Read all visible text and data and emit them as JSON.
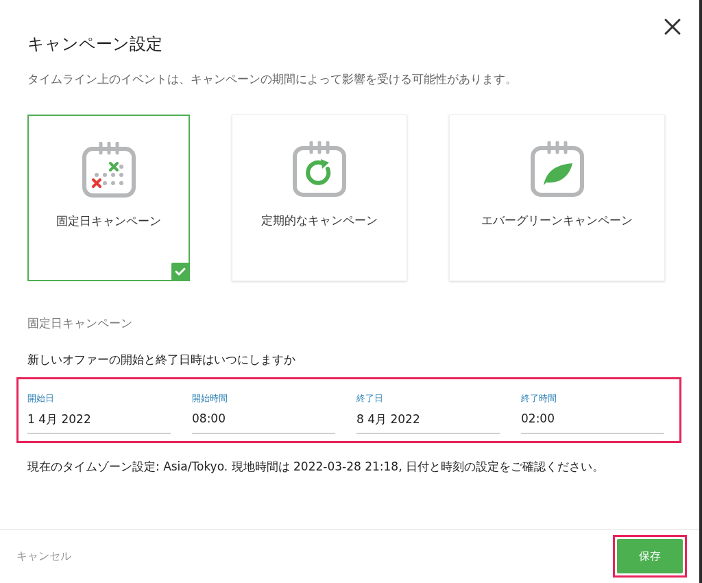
{
  "dialog": {
    "title": "キャンペーン設定",
    "description": "タイムライン上のイベントは、キャンペーンの期間によって影響を受ける可能性があります。"
  },
  "campaign_types": [
    {
      "kind": "fixed",
      "label": "固定日キャンペーン",
      "selected": true
    },
    {
      "kind": "recurring",
      "label": "定期的なキャンペーン",
      "selected": false
    },
    {
      "kind": "evergreen",
      "label": "エバーグリーンキャンペーン",
      "selected": false
    }
  ],
  "section_title": "固定日キャンペーン",
  "question": "新しいオファーの開始と終了日時はいつにしますか",
  "fields": [
    {
      "label": "開始日",
      "value": "1 4月 2022"
    },
    {
      "label": "開始時間",
      "value": "08:00"
    },
    {
      "label": "終了日",
      "value": "8 4月 2022"
    },
    {
      "label": "終了時間",
      "value": "02:00"
    }
  ],
  "timezone_note": "現在のタイムゾーン設定: Asia/Tokyo. 現地時間は 2022-03-28 21:18, 日付と時刻の設定をご確認ください。",
  "footer": {
    "cancel": "キャンセル",
    "save": "保存"
  }
}
